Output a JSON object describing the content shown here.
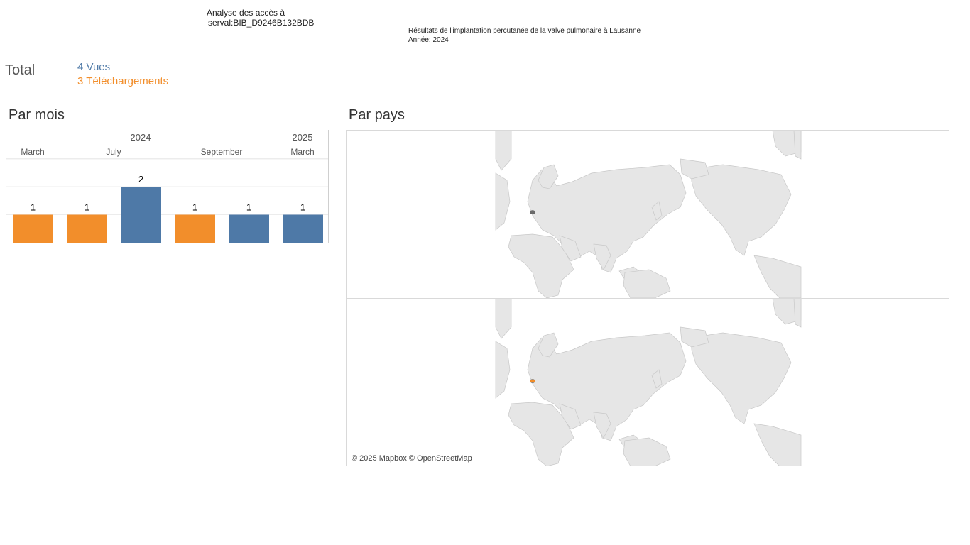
{
  "header": {
    "title_line1": "Analyse des accès à",
    "title_line2": "serval:BIB_D9246B132BDB",
    "publication_title": "Résultats de l'implantation percutanée de la valve pulmonaire à Lausanne",
    "publication_year": "Année: 2024"
  },
  "totals": {
    "label": "Total",
    "views": "4 Vues",
    "downloads": "3 Téléchargements"
  },
  "sections": {
    "by_month": "Par mois",
    "by_country": "Par pays"
  },
  "colors": {
    "views": "#4e79a7",
    "downloads": "#f28e2b",
    "land": "#e6e6e6",
    "border": "#c8c8c8"
  },
  "map": {
    "credit": "© 2025 Mapbox © OpenStreetMap",
    "highlight_views": "Switzerland",
    "highlight_downloads": "Switzerland"
  },
  "chart_data": {
    "type": "bar",
    "years": [
      {
        "label": "2024",
        "months": [
          "March",
          "July",
          "September"
        ]
      },
      {
        "label": "2025",
        "months": [
          "March"
        ]
      }
    ],
    "bars": [
      {
        "year": "2024",
        "month": "March",
        "metric": "downloads",
        "value": 1
      },
      {
        "year": "2024",
        "month": "July",
        "metric": "downloads",
        "value": 1
      },
      {
        "year": "2024",
        "month": "July",
        "metric": "views",
        "value": 2
      },
      {
        "year": "2024",
        "month": "September",
        "metric": "downloads",
        "value": 1
      },
      {
        "year": "2024",
        "month": "September",
        "metric": "views",
        "value": 1
      },
      {
        "year": "2025",
        "month": "March",
        "metric": "views",
        "value": 1
      }
    ],
    "ylim": [
      0,
      3
    ],
    "grid": true
  }
}
